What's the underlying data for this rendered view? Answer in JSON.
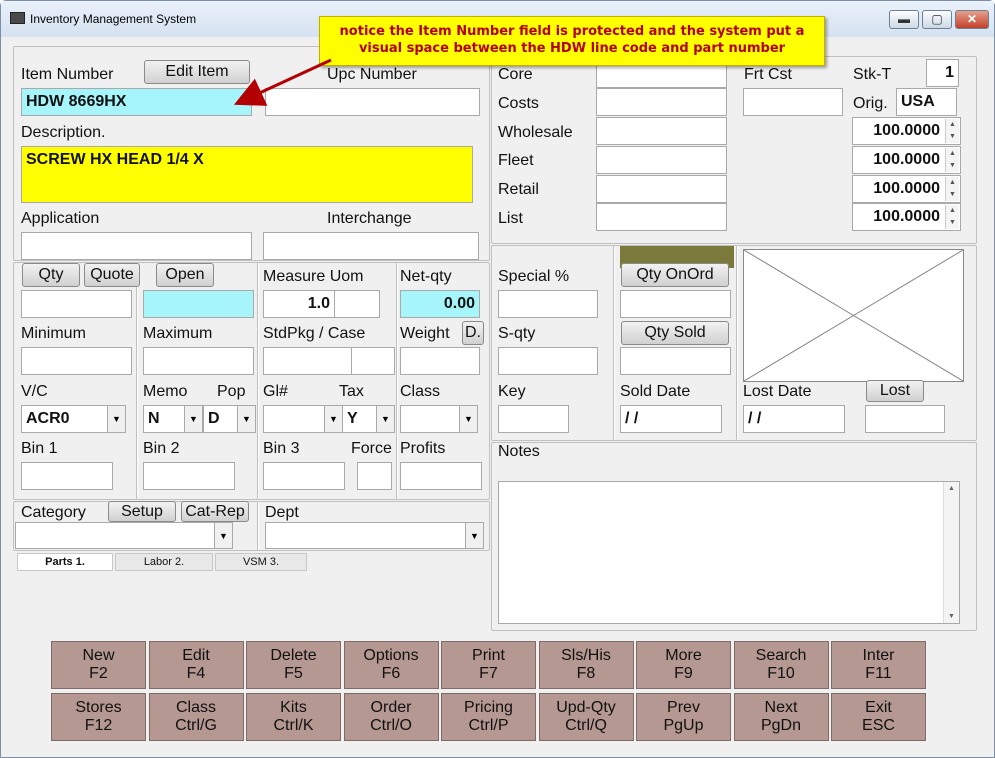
{
  "window": {
    "title": "Inventory Management System",
    "min": "▬",
    "max": "▢",
    "close": "✕"
  },
  "callout": {
    "line1": "notice the Item Number field is protected and the system put a",
    "line2": "visual space between the HDW line code and part number"
  },
  "item": {
    "item_number_label": "Item Number",
    "item_number": "HDW 8669HX",
    "edit_item_button": "Edit Item",
    "upc_label": "Upc  Number",
    "upc": "",
    "description_label": "Description.",
    "description": "SCREW  HX HEAD 1/4 X",
    "application_label": "Application",
    "application": "",
    "interchange_label": "Interchange",
    "interchange": ""
  },
  "qty": {
    "qty_button": "Qty",
    "quote_button": "Quote",
    "open_button": "Open",
    "qty_value": "",
    "open_value": "",
    "measure_uom_label": "Measure Uom",
    "measure_uom": "1.0",
    "net_qty_label": "Net-qty",
    "net_qty": "0.00",
    "minimum_label": "Minimum",
    "maximum_label": "Maximum",
    "stdpkg_label": "StdPkg / Case",
    "weight_label": "Weight",
    "weight_button": "D.",
    "vc_label": "V/C",
    "vc_value": "ACR0",
    "memo_label": "Memo",
    "memo_value": "N",
    "pop_label": "Pop",
    "pop_value": "D",
    "gl_label": "Gl#",
    "tax_label": "Tax",
    "tax_value": "Y",
    "class_label": "Class",
    "bin1_label": "Bin 1",
    "bin2_label": "Bin 2",
    "bin3_label": "Bin 3",
    "force_label": "Force",
    "profits_label": "Profits"
  },
  "pricing": {
    "core_label": "Core",
    "costs_label": "Costs",
    "wholesale_label": "Wholesale",
    "fleet_label": "Fleet",
    "retail_label": "Retail",
    "list_label": "List",
    "frt_cst_label": "Frt Cst",
    "stk_t_label": "Stk-T",
    "stk_t_value": "1",
    "orig_label": "Orig.",
    "orig_value": "USA",
    "pct": [
      "100.0000",
      "100.0000",
      "100.0000",
      "100.0000"
    ]
  },
  "stats": {
    "special_pct_label": "Special %",
    "s_qty_label": "S-qty",
    "key_label": "Key",
    "qty_onord_button": "Qty OnOrd",
    "qty_sold_button": "Qty Sold",
    "sold_date_label": "Sold Date",
    "sold_date": " / /",
    "lost_date_label": "Lost Date",
    "lost_date": " / /",
    "lost_button": "Lost"
  },
  "notes": {
    "label": "Notes",
    "value": ""
  },
  "category": {
    "category_label": "Category",
    "setup_button": "Setup",
    "cat_rep_button": "Cat-Rep",
    "dept_label": "Dept"
  },
  "tabs": [
    "Parts 1.",
    "Labor 2.",
    "VSM 3."
  ],
  "fkeys_row1": [
    {
      "l1": "New",
      "l2": "F2"
    },
    {
      "l1": "Edit",
      "l2": "F4"
    },
    {
      "l1": "Delete",
      "l2": "F5"
    },
    {
      "l1": "Options",
      "l2": "F6"
    },
    {
      "l1": "Print",
      "l2": "F7"
    },
    {
      "l1": "Sls/His",
      "l2": "F8"
    },
    {
      "l1": "More",
      "l2": "F9"
    },
    {
      "l1": "Search",
      "l2": "F10"
    },
    {
      "l1": "Inter",
      "l2": "F11"
    }
  ],
  "fkeys_row2": [
    {
      "l1": "Stores",
      "l2": "F12"
    },
    {
      "l1": "Class",
      "l2": "Ctrl/G"
    },
    {
      "l1": "Kits",
      "l2": "Ctrl/K"
    },
    {
      "l1": "Order",
      "l2": "Ctrl/O"
    },
    {
      "l1": "Pricing",
      "l2": "Ctrl/P"
    },
    {
      "l1": "Upd-Qty",
      "l2": "Ctrl/Q"
    },
    {
      "l1": "Prev",
      "l2": "PgUp"
    },
    {
      "l1": "Next",
      "l2": "PgDn"
    },
    {
      "l1": "Exit",
      "l2": "ESC"
    }
  ]
}
